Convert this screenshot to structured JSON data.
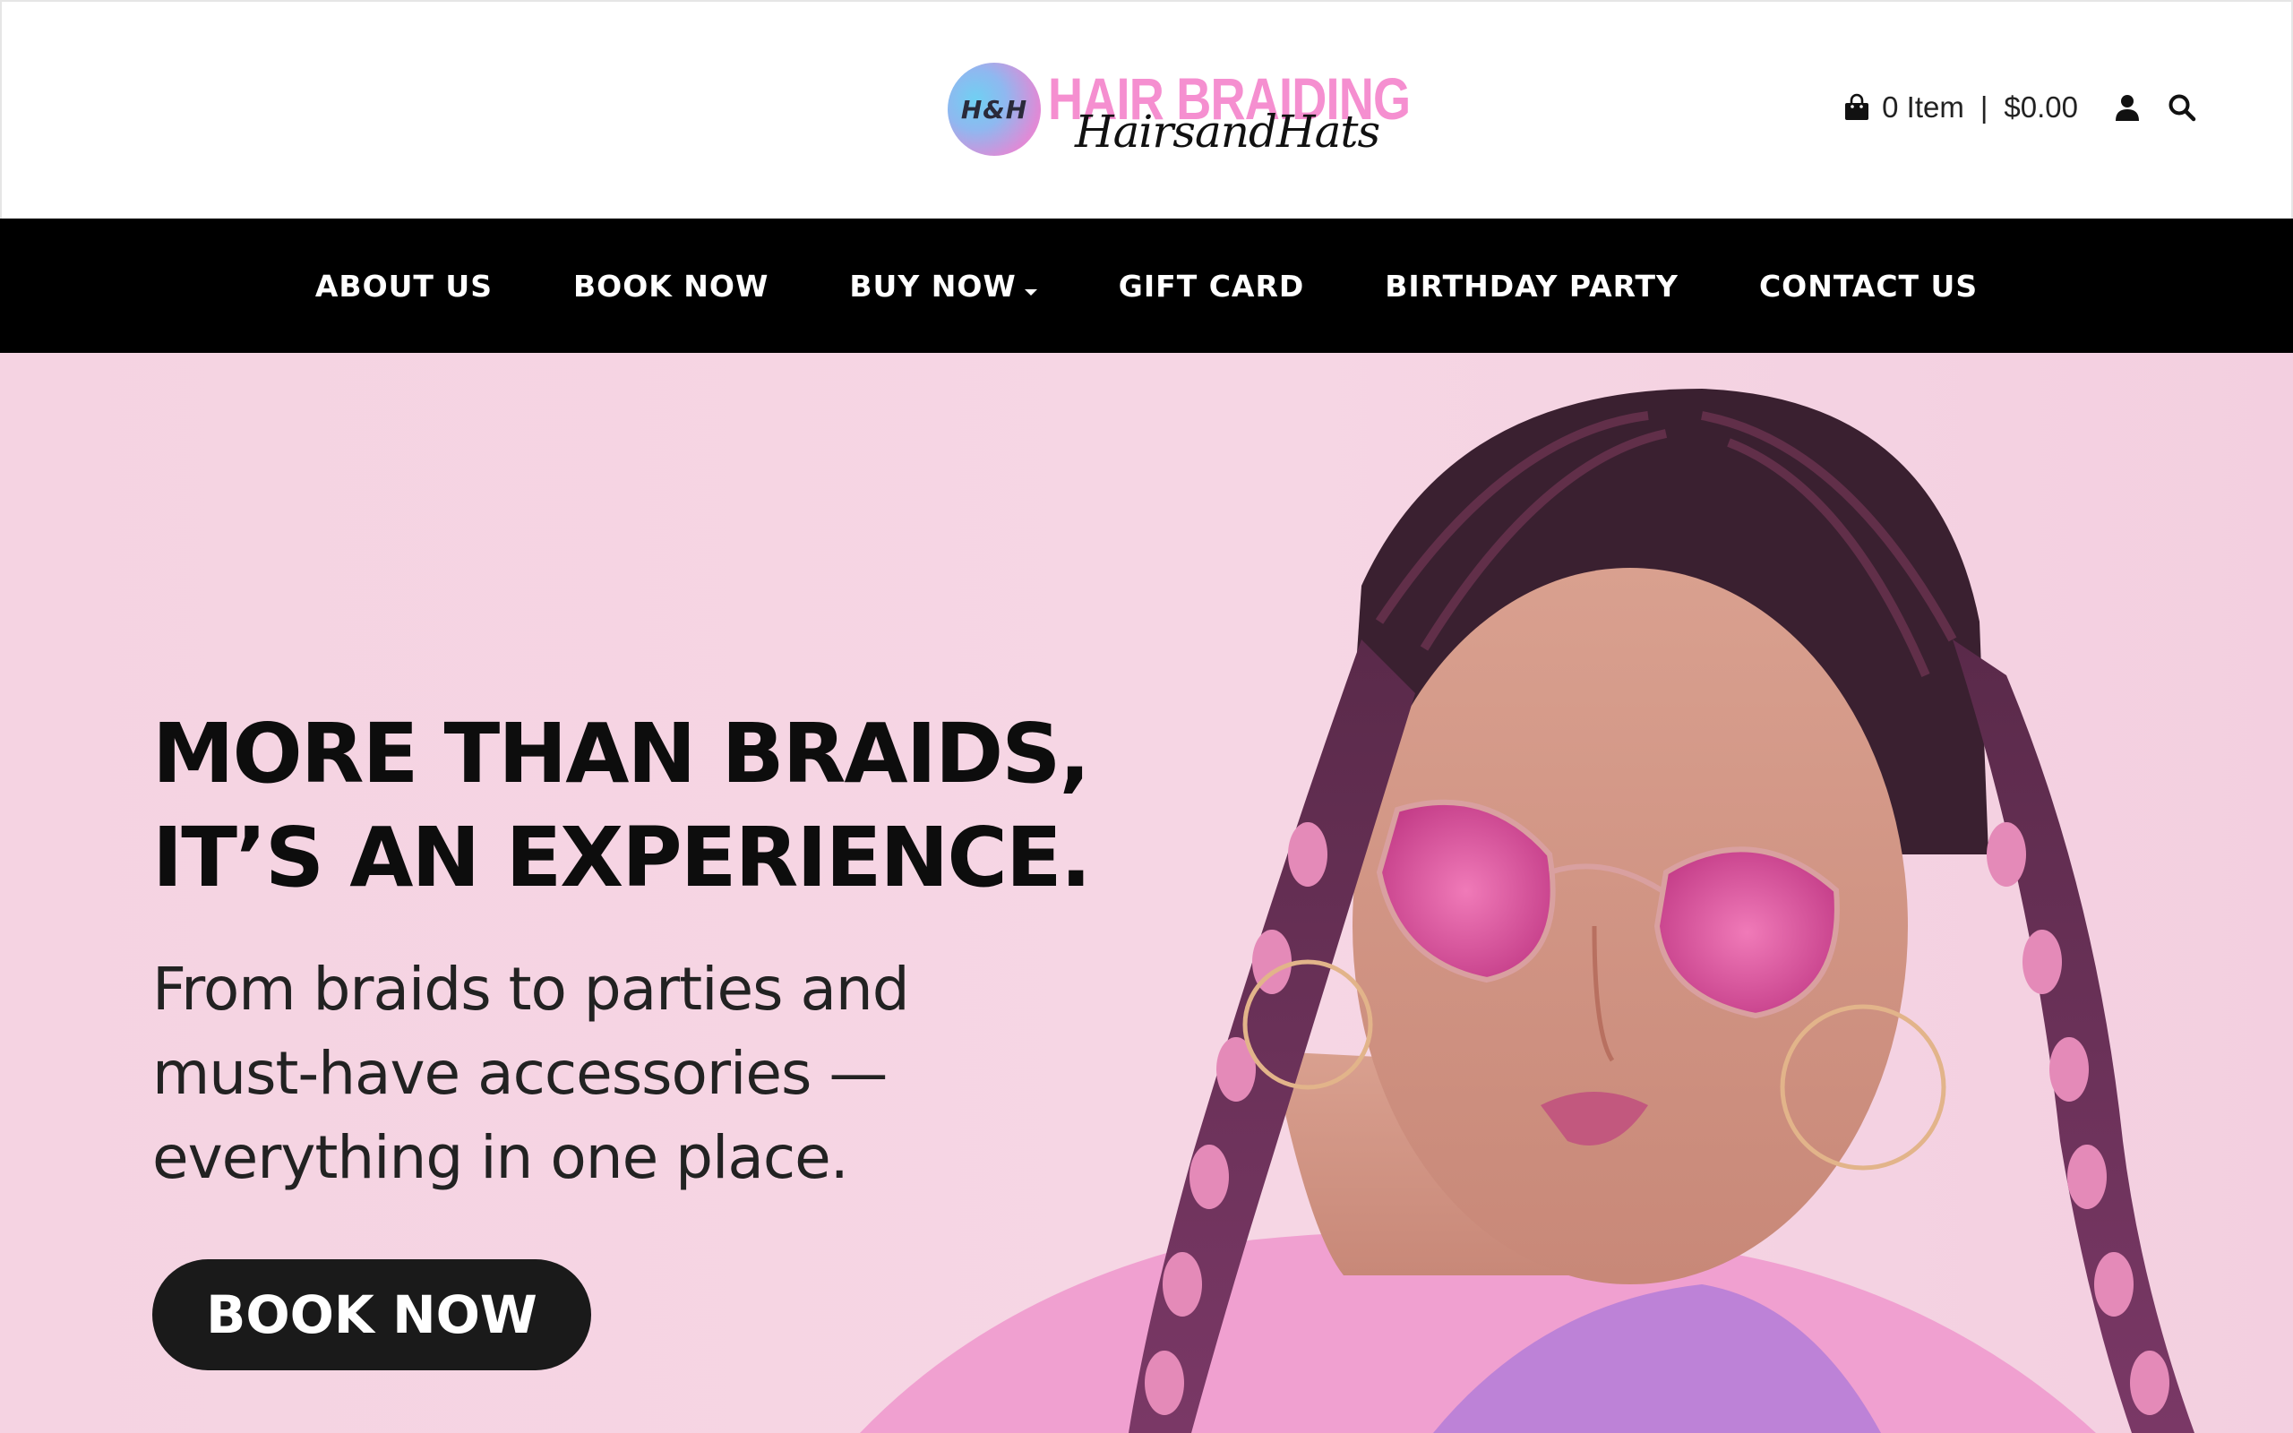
{
  "brand": {
    "badge_text": "H&H",
    "name": "HAIR BRAIDING",
    "script": "HairsandHats",
    "pink": "#f58fd0",
    "accent_blue": "#6fd0f2"
  },
  "header": {
    "cart_count_label": "0 Item",
    "cart_separator": "|",
    "cart_total": "$0.00",
    "icons": [
      "shopping-bag-icon",
      "user-icon",
      "search-icon"
    ]
  },
  "nav": {
    "items": [
      {
        "label": "ABOUT US"
      },
      {
        "label": "BOOK NOW"
      },
      {
        "label": "BUY NOW",
        "has_dropdown": true
      },
      {
        "label": "GIFT CARD"
      },
      {
        "label": "BIRTHDAY PARTY"
      },
      {
        "label": "CONTACT US"
      }
    ]
  },
  "hero": {
    "title_line1": "MORE THAN BRAIDS,",
    "title_line2": "IT’S AN EXPERIENCE.",
    "sub_line1": "From braids to parties and",
    "sub_line2": "must-have accessories —",
    "sub_line3": "everything in one place.",
    "cta_label": "BOOK NOW",
    "background": "#f5d3e2"
  }
}
